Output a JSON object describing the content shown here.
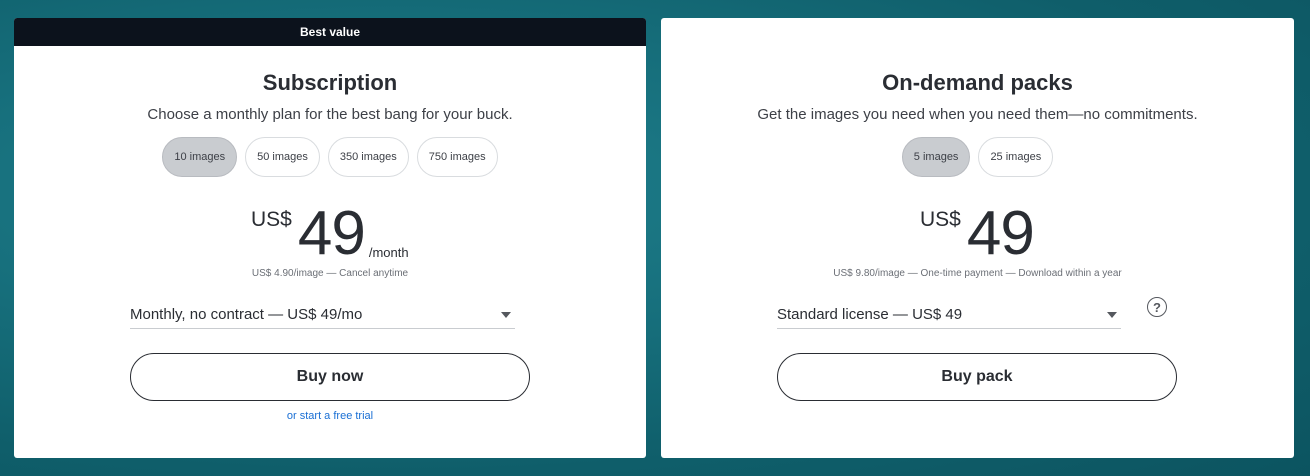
{
  "subscription": {
    "badge": "Best value",
    "title": "Subscription",
    "subtitle": "Choose a monthly plan for the best bang for your buck.",
    "options": [
      {
        "label": "10 images",
        "selected": true
      },
      {
        "label": "50 images",
        "selected": false
      },
      {
        "label": "350 images",
        "selected": false
      },
      {
        "label": "750 images",
        "selected": false
      }
    ],
    "currency": "US$",
    "amount": "49",
    "period": "/month",
    "fine_print": "US$ 4.90/image — Cancel anytime",
    "select_value": "Monthly, no contract — US$ 49/mo",
    "button": "Buy now",
    "trial_link": "or start a free trial"
  },
  "on_demand": {
    "title": "On-demand packs",
    "subtitle": "Get the images you need when you need them—no commitments.",
    "options": [
      {
        "label": "5 images",
        "selected": true
      },
      {
        "label": "25 images",
        "selected": false
      }
    ],
    "currency": "US$",
    "amount": "49",
    "fine_print": "US$ 9.80/image — One-time payment — Download within a year",
    "select_value": "Standard license — US$ 49",
    "help": "?",
    "button": "Buy pack"
  }
}
